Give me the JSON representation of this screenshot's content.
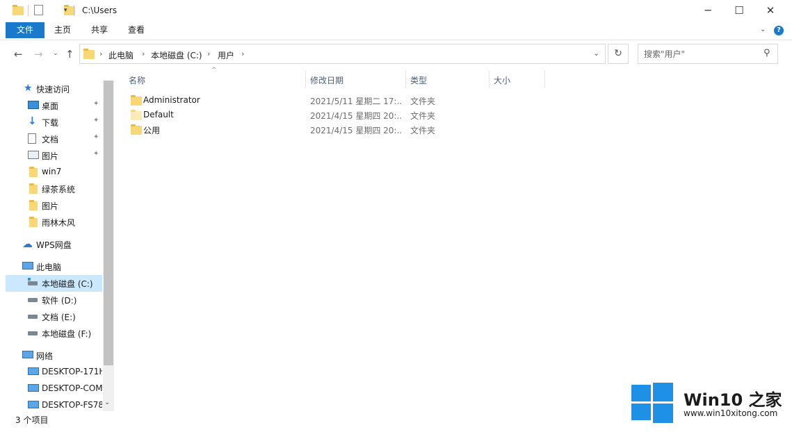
{
  "window": {
    "path_title": "C:\\Users",
    "minimize_icon": "minimize-icon",
    "maximize_icon": "maximize-icon",
    "close_icon": "close-icon"
  },
  "ribbon": {
    "tabs": [
      "文件",
      "主页",
      "共享",
      "查看"
    ]
  },
  "address": {
    "crumbs": [
      "此电脑",
      "本地磁盘 (C:)",
      "用户"
    ]
  },
  "search": {
    "placeholder": "搜索\"用户\""
  },
  "nav": {
    "quick_access": "快速访问",
    "quick_items": [
      "桌面",
      "下载",
      "文档",
      "图片",
      "win7",
      "绿茶系统",
      "图片",
      "雨林木风"
    ],
    "wps": "WPS网盘",
    "this_pc": "此电脑",
    "drives": [
      "本地磁盘 (C:)",
      "软件 (D:)",
      "文档 (E:)",
      "本地磁盘 (F:)"
    ],
    "network": "网络",
    "computers": [
      "DESKTOP-171H",
      "DESKTOP-COM",
      "DESKTOP-FS78"
    ]
  },
  "columns": {
    "name": "名称",
    "date": "修改日期",
    "type": "类型",
    "size": "大小"
  },
  "files": [
    {
      "name": "Administrator",
      "date": "2021/5/11 星期二 17:...",
      "type": "文件夹"
    },
    {
      "name": "Default",
      "date": "2021/4/15 星期四 20:...",
      "type": "文件夹"
    },
    {
      "name": "公用",
      "date": "2021/4/15 星期四 20:...",
      "type": "文件夹"
    }
  ],
  "status": {
    "count": "3 个项目"
  },
  "watermark": {
    "title": "Win10 之家",
    "url": "www.win10xitong.com"
  },
  "colors": {
    "accent": "#1979ca",
    "selection": "#cce8ff",
    "folder": "#f8d775"
  }
}
